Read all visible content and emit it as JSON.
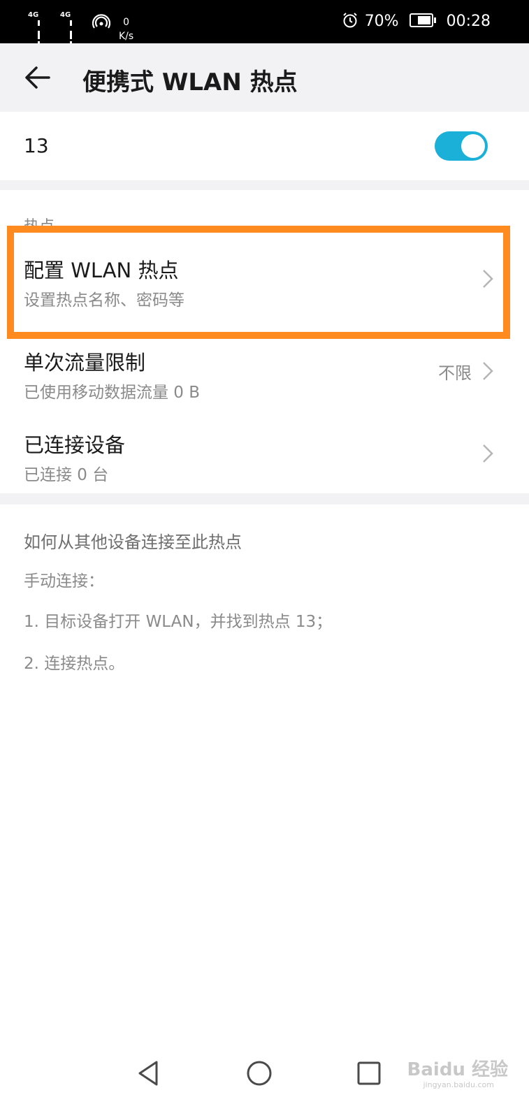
{
  "status_bar": {
    "signal1_label": "4G",
    "signal2_label": "4G",
    "speed_value": "0",
    "speed_unit": "K/s",
    "battery_percent": "70%",
    "battery_level": 0.7,
    "time": "00:28"
  },
  "app_bar": {
    "title": "便携式 WLAN 热点"
  },
  "hotspot_toggle": {
    "name": "13",
    "enabled": true,
    "accent_color": "#1ab0d8"
  },
  "settings": {
    "section_label": "热点",
    "items": [
      {
        "title": "配置 WLAN 热点",
        "subtitle": "设置热点名称、密码等",
        "value": ""
      },
      {
        "title": "单次流量限制",
        "subtitle": "已使用移动数据流量 0 B",
        "value": "不限"
      },
      {
        "title": "已连接设备",
        "subtitle": "已连接 0 台",
        "value": ""
      }
    ]
  },
  "highlight_color": "#ff8a1f",
  "help": {
    "title": "如何从其他设备连接至此热点",
    "line1": "手动连接：",
    "line2": "1. 目标设备打开 WLAN，并找到热点 13；",
    "line3": "2. 连接热点。"
  },
  "nav_bar": {
    "watermark": "Baidu 经验",
    "watermark_sub": "jingyan.baidu.com"
  }
}
